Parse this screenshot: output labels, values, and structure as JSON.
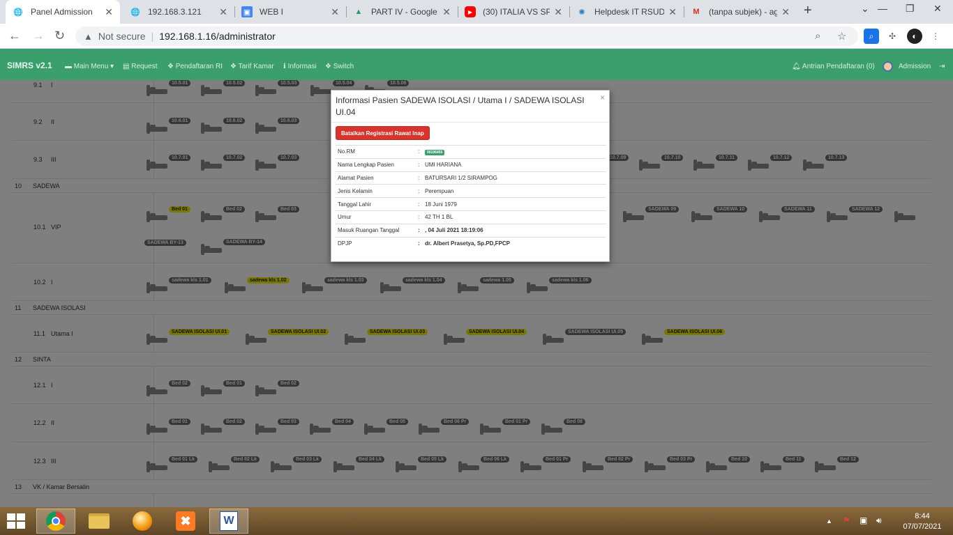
{
  "browser": {
    "tabs": [
      {
        "title": "Panel Admission",
        "icon": "globe-icon",
        "active": true
      },
      {
        "title": "192.168.3.121",
        "icon": "globe-icon"
      },
      {
        "title": "WEB I",
        "icon": "contacts-icon"
      },
      {
        "title": "PART IV - Google",
        "icon": "drive-icon"
      },
      {
        "title": "(30) ITALIA VS SPA",
        "icon": "youtube-icon"
      },
      {
        "title": "Helpdesk IT RSUD",
        "icon": "helpdesk-icon"
      },
      {
        "title": "(tanpa subjek) - ag",
        "icon": "gmail-icon"
      }
    ],
    "not_secure": "Not secure",
    "url": "192.168.1.16/administrator"
  },
  "navbar": {
    "brand": "SIMRS v2.1",
    "items": [
      "Main Menu",
      "Request",
      "Pendaftaran RI",
      "Tarif Kamar",
      "Informasi",
      "Switch"
    ],
    "antrian": "Antrian Pendaftaran (0)",
    "user": "Admission"
  },
  "rooms": [
    {
      "no": "9.1",
      "cls": "I",
      "beds": [
        "10.5.01",
        "10.5.02",
        "10.5.03",
        "10.5.04",
        "10.5.06"
      ]
    },
    {
      "no": "9.2",
      "cls": "II",
      "beds": [
        "10.6.01",
        "10.6.02",
        "10.6.03"
      ]
    },
    {
      "no": "9.3",
      "cls": "III",
      "beds": [
        "10.7.01",
        "10.7.02",
        "10.7.03",
        "10.7.09",
        "10.7.10",
        "10.7.11",
        "10.7.12",
        "10.7.13"
      ]
    },
    {
      "no": "10",
      "cls": "SADEWA"
    },
    {
      "no": "10.1",
      "cls": "VIP",
      "beds": [
        "Bed 01",
        "Bed 02",
        "Bed 03",
        "SADEWA 09",
        "SADEWA 10",
        "SADEWA 11",
        "SADEWA 12",
        "SADEWA BY-13",
        "SADEWA BY-14"
      ]
    },
    {
      "no": "10.2",
      "cls": "I",
      "beds": [
        "sadewa kls 1.01",
        "sadewa kls 1.02",
        "sadewa kls 1.03",
        "sadewa kls 1.04",
        "sadewa 1.05",
        "sadewa kls 1.06"
      ]
    },
    {
      "no": "11",
      "cls": "SADEWA ISOLASI"
    },
    {
      "no": "11.1",
      "cls": "Utama I",
      "beds": [
        "SADEWA ISOLASI UI.01",
        "SADEWA ISOLASI UI.02",
        "SADEWA ISOLASI UI.03",
        "SADEWA ISOLASI UI.04",
        "SADEWA ISOLASI UI.05",
        "SADEWA ISOLASI UI.06"
      ]
    },
    {
      "no": "12",
      "cls": "SINTA"
    },
    {
      "no": "12.1",
      "cls": "I",
      "beds": [
        "Bed 02",
        "Bed 01",
        "Bed 02"
      ]
    },
    {
      "no": "12.2",
      "cls": "II",
      "beds": [
        "Bed 01",
        "Bed 02",
        "Bed 03",
        "Bed 04",
        "Bed 05",
        "Bed 06 Pr",
        "Bed 01 Pr",
        "Bed 08"
      ]
    },
    {
      "no": "12.3",
      "cls": "III",
      "beds": [
        "Bed 01 Lk",
        "Bed 02 Lk",
        "Bed 03 Lk",
        "Bed 04 Lk",
        "Bed 05 Lk",
        "Bed 06 Lk",
        "Bed 01 Pr",
        "Bed 02 Pr",
        "Bed 03 Pr",
        "Bed 10",
        "Bed 11",
        "Bed 12"
      ]
    },
    {
      "no": "13",
      "cls": "VK / Kamar Bersalin"
    }
  ],
  "modal": {
    "title": "Informasi Pasien SADEWA ISOLASI / Utama I / SADEWA ISOLASI UI.04",
    "close": "×",
    "cancel_button": "Batalkan Registrasi Rawat Inap",
    "fields": [
      {
        "label": "No.RM",
        "value": "00106455"
      },
      {
        "label": "Nama Lengkap Pasien",
        "value": "UMI HARIANA"
      },
      {
        "label": "Alamat Pasien",
        "value": "BATURSARI 1/2 SIRAMPOG"
      },
      {
        "label": "Jenis Kelamin",
        "value": "Perempuan"
      },
      {
        "label": "Tanggal Lahir",
        "value": "18 Juni 1979"
      },
      {
        "label": "Umur",
        "value": "42 TH 1 BL"
      },
      {
        "label": "Masuk Ruangan Tanggal",
        "value": ", 04 Juli 2021 18:19:06"
      },
      {
        "label": "DPJP",
        "value": "dr. Albert Prasetya, Sp.PD,FPCP"
      }
    ]
  },
  "taskbar": {
    "time": "8:44",
    "date": "07/07/2021"
  }
}
